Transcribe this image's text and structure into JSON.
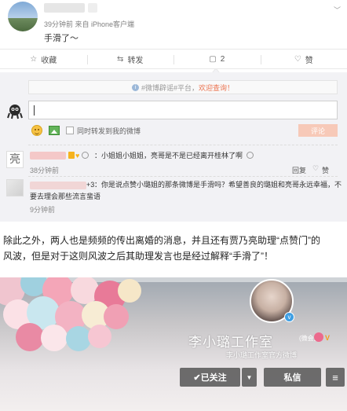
{
  "post": {
    "meta": "39分钟前 来自 iPhone客户端",
    "text": "手滑了～",
    "caret": "﹀"
  },
  "actions": [
    {
      "icon": "☆",
      "label": "收藏"
    },
    {
      "icon": "⇆",
      "label": "转发"
    },
    {
      "icon": "▢",
      "label": "2"
    },
    {
      "icon": "♡",
      "label": "赞"
    }
  ],
  "notice": {
    "prefix": "#微博辟谣#平台，",
    "link": "欢迎查询！"
  },
  "comment_box": {
    "repost_label": "同时转发到我的微博",
    "submit_label": "评论"
  },
  "comments": [
    {
      "text": "：小姐姐小姐姐，亮哥是不是已经离开桂林了啊",
      "time": "38分钟前",
      "reply": "回复",
      "like": "赞"
    },
    {
      "name_suffix": "+3",
      "text_line1": "：你是说点赞小璐姐的那条微博是手滑吗？希望善良的璐姐和亮哥永远幸福，不",
      "text_line2": "要去理会那些流言蜚语",
      "time": "9分钟前"
    }
  ],
  "article": {
    "line1": "除此之外，两人也是频频的传出离婚的消息，并且还有贾乃亮助理“点赞门”的",
    "line2": "风波，但是对于这则风波之后其助理发言也是经过解释“手滑了”！"
  },
  "profile": {
    "name": "李小璐工作室",
    "member_tag": "(微会员)",
    "member_v": "V",
    "verify": "v",
    "subtitle": "李小璐工作室官方微博",
    "follow_label": "✔已关注",
    "dropdown_label": "▼",
    "message_label": "私信",
    "more_label": "≡"
  },
  "colors": {
    "accent": "#eb7350",
    "link": "#eb7350",
    "panel_bg": "#f2f2f5"
  }
}
